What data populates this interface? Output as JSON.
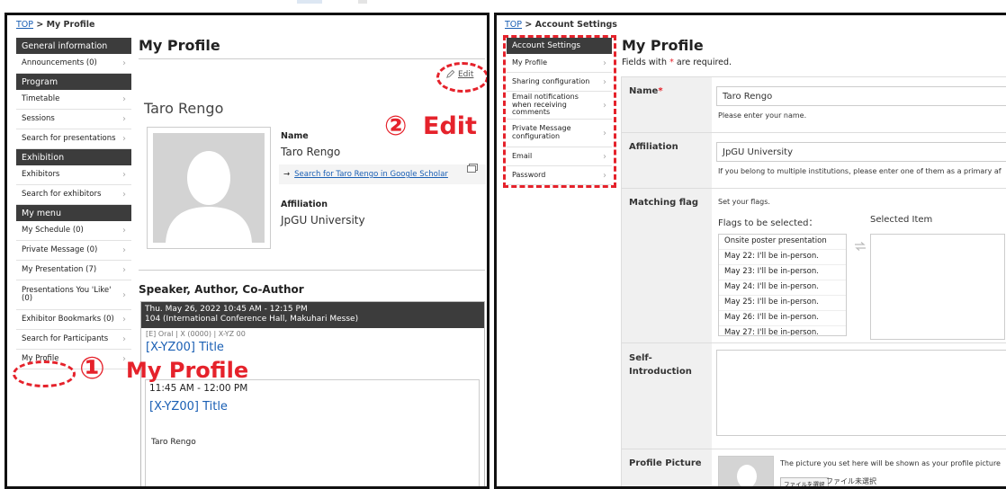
{
  "left": {
    "breadcrumb": {
      "top": "TOP",
      "sep": " > ",
      "current": "My Profile"
    },
    "sidebar": [
      {
        "type": "head",
        "label": "General information"
      },
      {
        "type": "item",
        "label": "Announcements (0)"
      },
      {
        "type": "head",
        "label": "Program"
      },
      {
        "type": "item",
        "label": "Timetable"
      },
      {
        "type": "item",
        "label": "Sessions"
      },
      {
        "type": "item",
        "label": "Search for presentations"
      },
      {
        "type": "head",
        "label": "Exhibition"
      },
      {
        "type": "item",
        "label": "Exhibitors"
      },
      {
        "type": "item",
        "label": "Search for exhibitors"
      },
      {
        "type": "head",
        "label": "My menu"
      },
      {
        "type": "item",
        "label": "My Schedule (0)"
      },
      {
        "type": "item",
        "label": "Private Message (0)"
      },
      {
        "type": "item",
        "label": "My Presentation (7)"
      },
      {
        "type": "item",
        "label": "Presentations You 'Like' (0)"
      },
      {
        "type": "item",
        "label": "Exhibitor Bookmarks (0)"
      },
      {
        "type": "item",
        "label": "Search for Participants"
      },
      {
        "type": "item",
        "label": "My Profile"
      }
    ],
    "page_title": "My Profile",
    "edit_label": "Edit",
    "user_name": "Taro Rengo",
    "name_label": "Name",
    "name_value": "Taro Rengo",
    "scholar_arrow": "→",
    "scholar_link": "Search for Taro Rengo in Google Scholar",
    "affiliation_label": "Affiliation",
    "affiliation_value": "JpGU University",
    "section_heading": "Speaker, Author, Co-Author",
    "session": {
      "time": "Thu. May 26, 2022 10:45 AM - 12:15 PM",
      "room": "104 (International Conference Hall, Makuhari Messe)",
      "meta": "[E] Oral | X (0000) | X-YZ 00",
      "title": "[X-YZ00] Title",
      "sub_time": "11:45 AM - 12:00 PM",
      "sub_title": "[X-YZ00] Title",
      "sub_author": "Taro Rengo"
    },
    "annotation_1": "①",
    "annotation_1_text": "My Profile",
    "annotation_2": "②",
    "annotation_2_text": "Edit"
  },
  "right": {
    "breadcrumb": {
      "top": "TOP",
      "sep": " > ",
      "current": "Account Settings"
    },
    "sidebar_head": "Account Settings",
    "sidebar": [
      "My Profile",
      "Sharing configuration",
      "Email notifications when receiving comments",
      "Private Message configuration",
      "Email",
      "Password"
    ],
    "page_title": "My Profile",
    "required_note_pre": "Fields with ",
    "required_star": "*",
    "required_note_post": " are required.",
    "name_label": "Name",
    "name_value": "Taro Rengo",
    "name_help": "Please enter your name.",
    "affiliation_label": "Affiliation",
    "affiliation_value": "JpGU University",
    "affiliation_help": "If you belong to multiple institutions, please enter one of them as a primary af",
    "flag_label": "Matching flag",
    "flag_help": "Set your flags.",
    "flags_to_select": "Flags to be selected：",
    "selected_item": "Selected Item",
    "flag_options": [
      "Onsite poster presentation",
      "May 22: I'll be in-person.",
      "May 23: I'll be in-person.",
      "May 24: I'll be in-person.",
      "May 25: I'll be in-person.",
      "May 26: I'll be in-person.",
      "May 27: I'll be in-person."
    ],
    "self_intro_label": "Self-Introduction",
    "picture_label": "Profile Picture",
    "picture_help": "The picture you set here will be shown as your profile picture",
    "file_button": "ファイルを選択",
    "file_status": "ファイル未選択"
  }
}
